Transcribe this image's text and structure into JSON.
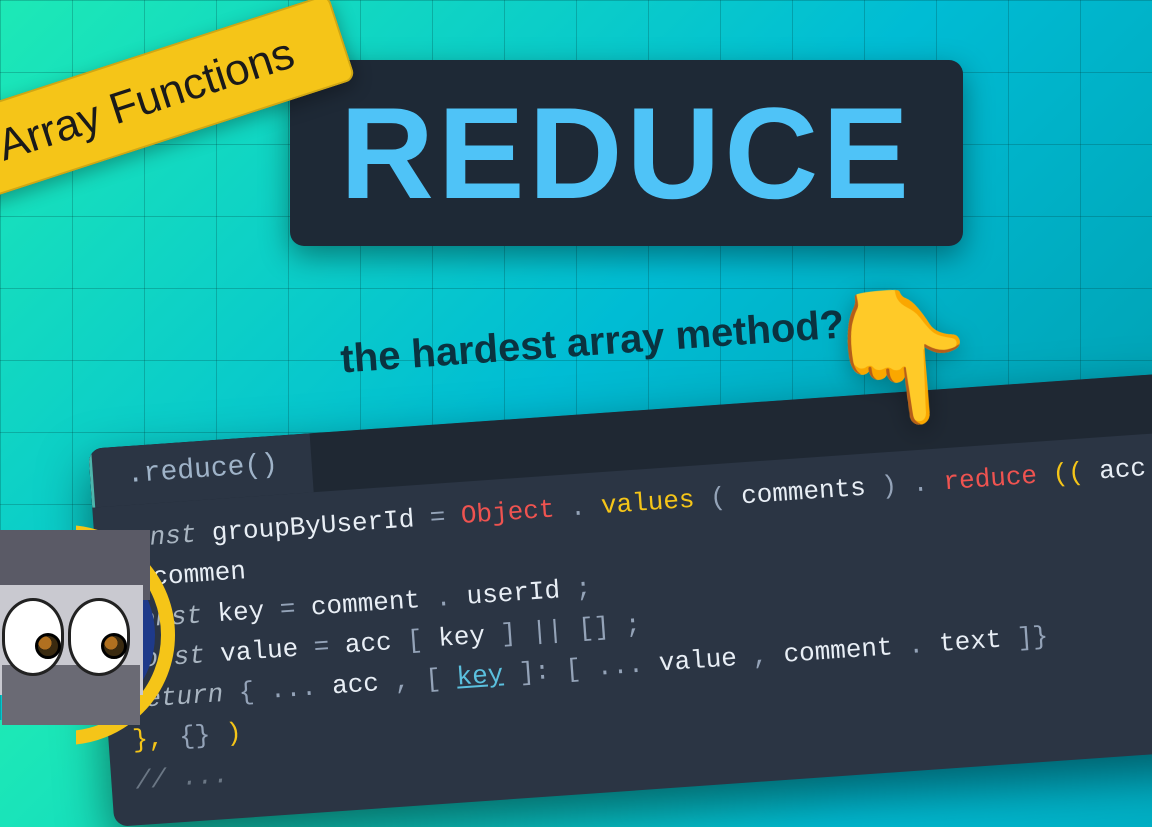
{
  "badge": {
    "label": "Array Functions"
  },
  "title": {
    "text": "REDUCE"
  },
  "subtitle": {
    "text": "the hardest array method?"
  },
  "pointer": {
    "emoji": "👇"
  },
  "editor": {
    "tab": ".reduce()",
    "code": {
      "line1": {
        "kw": "const",
        "var": "groupByUserId",
        "eq": " = ",
        "obj": "Object",
        "dot1": ".",
        "fn": "values",
        "p1": "(",
        "arg": "comments",
        "p2": ")",
        "dot2": ".",
        "method": "reduce",
        "p3": "((",
        "a": "acc",
        "c1": ", ",
        "b": "commen"
      },
      "line2": {
        "indent": "  ",
        "kw": "const",
        "var": "key",
        "eq": " = ",
        "a": "comment",
        "dot": ".",
        "b": "userId",
        "sc": ";"
      },
      "line3": {
        "indent": "  ",
        "kw": "const",
        "var": "value",
        "eq": " = ",
        "a": "acc",
        "b1": "[",
        "k": "key",
        "b2": "]",
        "or": " || ",
        "arr": "[]",
        "sc": ";"
      },
      "line4": {
        "indent": "  ",
        "kw": "return",
        "sp": " ",
        "open": "{ ...",
        "acc": "acc",
        "c1": ", [",
        "key": "key",
        "c2": "]: [ ...",
        "val": "value",
        "c3": ", ",
        "cm": "comment",
        "dot": ".",
        "tx": "text",
        "close": "]}"
      },
      "line5": {
        "a": "}, ",
        "b": "{}",
        "c": ")"
      },
      "line6": {
        "indent": "    ",
        "comment": "// ..."
      }
    }
  }
}
